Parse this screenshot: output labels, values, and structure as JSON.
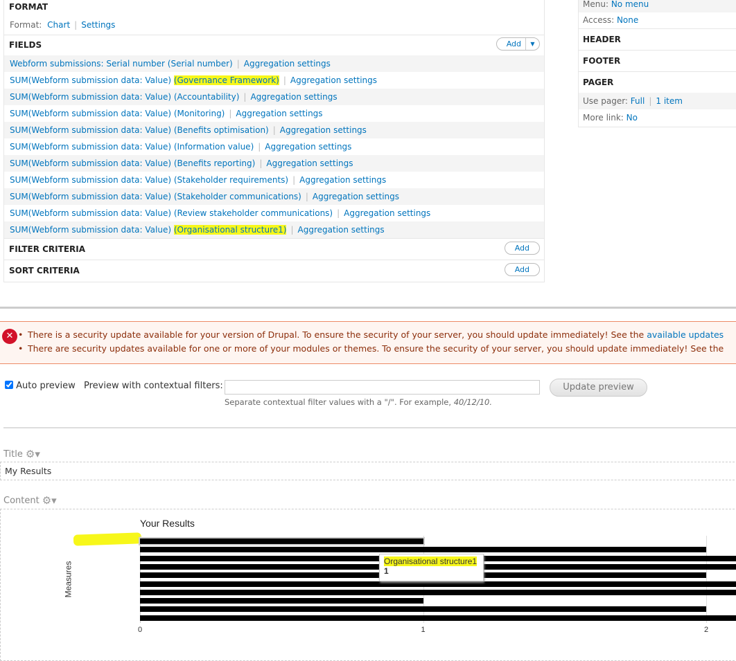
{
  "format": {
    "heading": "FORMAT",
    "label": "Format:",
    "format_link": "Chart",
    "settings_link": "Settings"
  },
  "fields": {
    "heading": "FIELDS",
    "add_label": "Add",
    "items": [
      {
        "text": "Webform submissions: Serial number (Serial number)",
        "prefix": "",
        "name": "",
        "highlight": false
      },
      {
        "prefix": "SUM(Webform submission data: Value) ",
        "name": "(Governance Framework)",
        "highlight": true
      },
      {
        "prefix": "SUM(Webform submission data: Value) ",
        "name": "(Accountability)",
        "highlight": false
      },
      {
        "prefix": "SUM(Webform submission data: Value) ",
        "name": "(Monitoring)",
        "highlight": false
      },
      {
        "prefix": "SUM(Webform submission data: Value) ",
        "name": "(Benefits optimisation)",
        "highlight": false
      },
      {
        "prefix": "SUM(Webform submission data: Value) ",
        "name": "(Information value)",
        "highlight": false
      },
      {
        "prefix": "SUM(Webform submission data: Value) ",
        "name": "(Benefits reporting)",
        "highlight": false
      },
      {
        "prefix": "SUM(Webform submission data: Value) ",
        "name": "(Stakeholder requirements)",
        "highlight": false
      },
      {
        "prefix": "SUM(Webform submission data: Value) ",
        "name": "(Stakeholder communications)",
        "highlight": false
      },
      {
        "prefix": "SUM(Webform submission data: Value) ",
        "name": "(Review stakeholder communications)",
        "highlight": false
      },
      {
        "prefix": "SUM(Webform submission data: Value) ",
        "name": "(Organisational structure1)",
        "highlight": true
      }
    ],
    "aggregation_label": "Aggregation settings"
  },
  "filter": {
    "heading": "FILTER CRITERIA",
    "add_label": "Add"
  },
  "sort": {
    "heading": "SORT CRITERIA",
    "add_label": "Add"
  },
  "right": {
    "menu_label": "Menu:",
    "menu_value": "No menu",
    "access_label": "Access:",
    "access_value": "None",
    "header": "HEADER",
    "footer": "FOOTER",
    "pager": "PAGER",
    "use_pager_label": "Use pager:",
    "use_pager_value": "Full",
    "items_value": "1 item",
    "more_link_label": "More link:",
    "more_link_value": "No"
  },
  "messages": {
    "items": [
      "There is a security update available for your version of Drupal. To ensure the security of your server, you should update immediately! See the ",
      "There are security updates available for one or more of your modules or themes. To ensure the security of your server, you should update immediately! See the"
    ],
    "link": "available updates"
  },
  "preview": {
    "auto_preview_label": "Auto preview",
    "auto_preview_checked": true,
    "contextual_label": "Preview with contextual filters:",
    "contextual_value": "",
    "help_prefix": "Separate contextual filter values with a \"/\". For example, ",
    "help_example": "40/12/10.",
    "update_button": "Update preview"
  },
  "display": {
    "title_label": "Title",
    "title_value": "My Results",
    "content_label": "Content"
  },
  "chart_data": {
    "type": "bar",
    "orientation": "horizontal",
    "title": "Your Results",
    "ylabel": "Measures",
    "xlabel": "",
    "x_ticks": [
      "0",
      "1",
      "2"
    ],
    "xlim": [
      0,
      2.1
    ],
    "values": [
      1,
      2,
      3,
      3,
      2,
      3,
      3,
      1,
      2,
      3
    ],
    "bar_color": "#000000",
    "tooltip": {
      "label": "Organisational structure1",
      "value": "1"
    }
  },
  "colors": {
    "link": "#0074bd",
    "highlight": "#f7f71a",
    "error_bg": "#fef5f1",
    "error_text": "#8c2e0b"
  }
}
